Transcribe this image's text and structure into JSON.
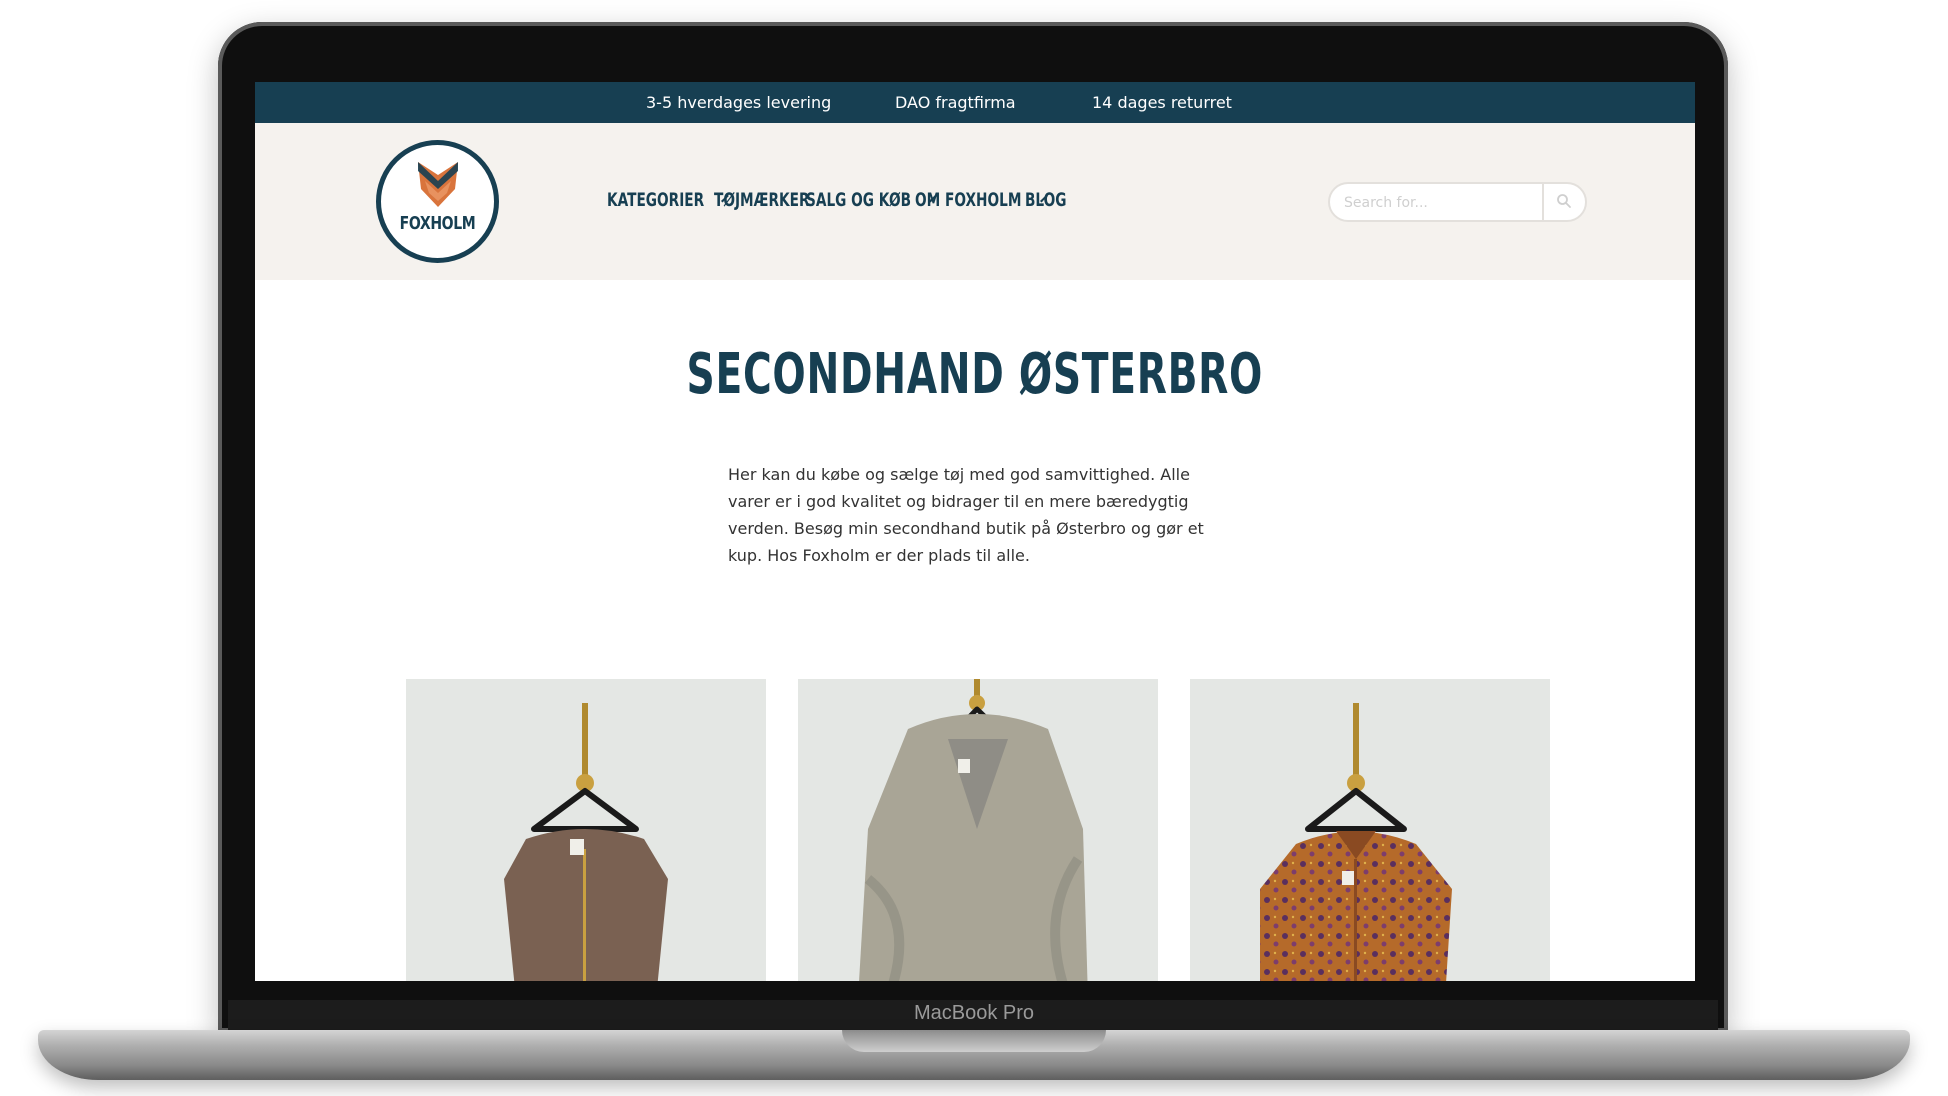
{
  "device": {
    "label": "MacBook Pro"
  },
  "topbar": {
    "items": [
      "3-5 hverdages levering",
      "DAO fragtfirma",
      "14 dages returret"
    ]
  },
  "logo": {
    "text": "FOXHOLM"
  },
  "nav": {
    "items": [
      {
        "label": "KATEGORIER",
        "dropdown": true
      },
      {
        "label": "TØJMÆRKER",
        "dropdown": false
      },
      {
        "label": "SALG OG KØB",
        "dropdown": true
      },
      {
        "label": "OM FOXHOLM",
        "dropdown": true
      },
      {
        "label": "BLOG",
        "dropdown": false
      }
    ]
  },
  "search": {
    "placeholder": "Search for..."
  },
  "main": {
    "title": "SECONDHAND ØSTERBRO",
    "intro": "Her kan du købe og sælge tøj med god samvittighed. Alle varer er i god kvalitet og bidrager til en mere bæredygtig verden. Besøg min secondhand butik på Østerbro og gør et kup. Hos Foxholm er der plads til alle."
  },
  "products": [
    {
      "image": "brown-zip-top-on-hanger",
      "color": "#7a6152"
    },
    {
      "image": "grey-fur-coat-on-hanger",
      "color": "#a9a596"
    },
    {
      "image": "orange-paisley-shirt-on-hanger",
      "color": "#b56a2a"
    }
  ],
  "colors": {
    "brand_dark": "#173f52",
    "brand_orange": "#d9743c",
    "header_bg": "#f5f2ee"
  }
}
